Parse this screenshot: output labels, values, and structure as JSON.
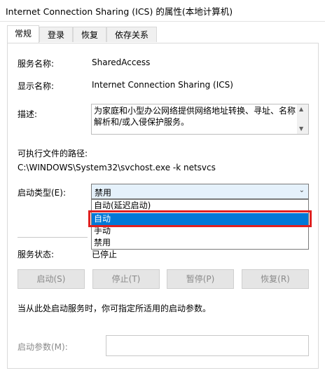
{
  "window": {
    "title": "Internet Connection Sharing (ICS) 的属性(本地计算机)"
  },
  "tabs": [
    {
      "label": "常规",
      "active": true
    },
    {
      "label": "登录",
      "active": false
    },
    {
      "label": "恢复",
      "active": false
    },
    {
      "label": "依存关系",
      "active": false
    }
  ],
  "general": {
    "service_name_label": "服务名称:",
    "service_name": "SharedAccess",
    "display_name_label": "显示名称:",
    "display_name": "Internet Connection Sharing (ICS)",
    "description_label": "描述:",
    "description": "为家庭和小型办公网络提供网络地址转换、寻址、名称解析和/或入侵保护服务。",
    "exe_path_label": "可执行文件的路径:",
    "exe_path": "C:\\WINDOWS\\System32\\svchost.exe -k netsvcs",
    "startup_type_label": "启动类型(E):",
    "startup_type_selected": "禁用",
    "startup_type_options": [
      "自动(延迟启动)",
      "自动",
      "手动",
      "禁用"
    ],
    "highlighted_option": "自动",
    "service_status_label": "服务状态:",
    "service_status": "已停止",
    "buttons": {
      "start": "启动(S)",
      "stop": "停止(T)",
      "pause": "暂停(P)",
      "resume": "恢复(R)"
    },
    "start_note": "当从此处启动服务时，你可指定所适用的启动参数。",
    "start_params_label": "启动参数(M):",
    "start_params_value": ""
  },
  "colors": {
    "highlight": "#0078d7",
    "annotation_box": "#e02020",
    "combo_bg": "#e5f1fb"
  }
}
